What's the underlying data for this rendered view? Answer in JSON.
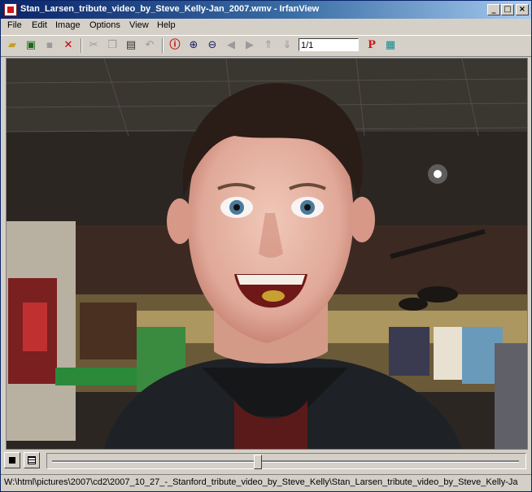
{
  "window": {
    "title": "Stan_Larsen_tribute_video_by_Steve_Kelly-Jan_2007.wmv - IrfanView"
  },
  "menu": [
    "File",
    "Edit",
    "Image",
    "Options",
    "View",
    "Help"
  ],
  "toolbar": {
    "page_value": "1/1",
    "icons": [
      "open-folder-icon",
      "slideshow-icon",
      "save-icon",
      "delete-icon",
      "cut-icon",
      "copy-icon",
      "paste-icon",
      "undo-icon",
      "info-icon",
      "zoom-in-icon",
      "zoom-out-icon",
      "previous-arrow-icon",
      "next-arrow-icon",
      "first-file-icon",
      "last-file-icon",
      "paint-p-icon",
      "thumbnails-icon"
    ]
  },
  "player": {
    "position_fraction": 0.44
  },
  "statusbar": {
    "path": "W:\\html\\pictures\\2007\\cd2\\2007_10_27_-_Stanford_tribute_video_by_Steve_Kelly\\Stan_Larsen_tribute_video_by_Steve_Kelly-Ja"
  },
  "colors": {
    "title_start": "#0a246a",
    "title_end": "#a6caf0"
  }
}
